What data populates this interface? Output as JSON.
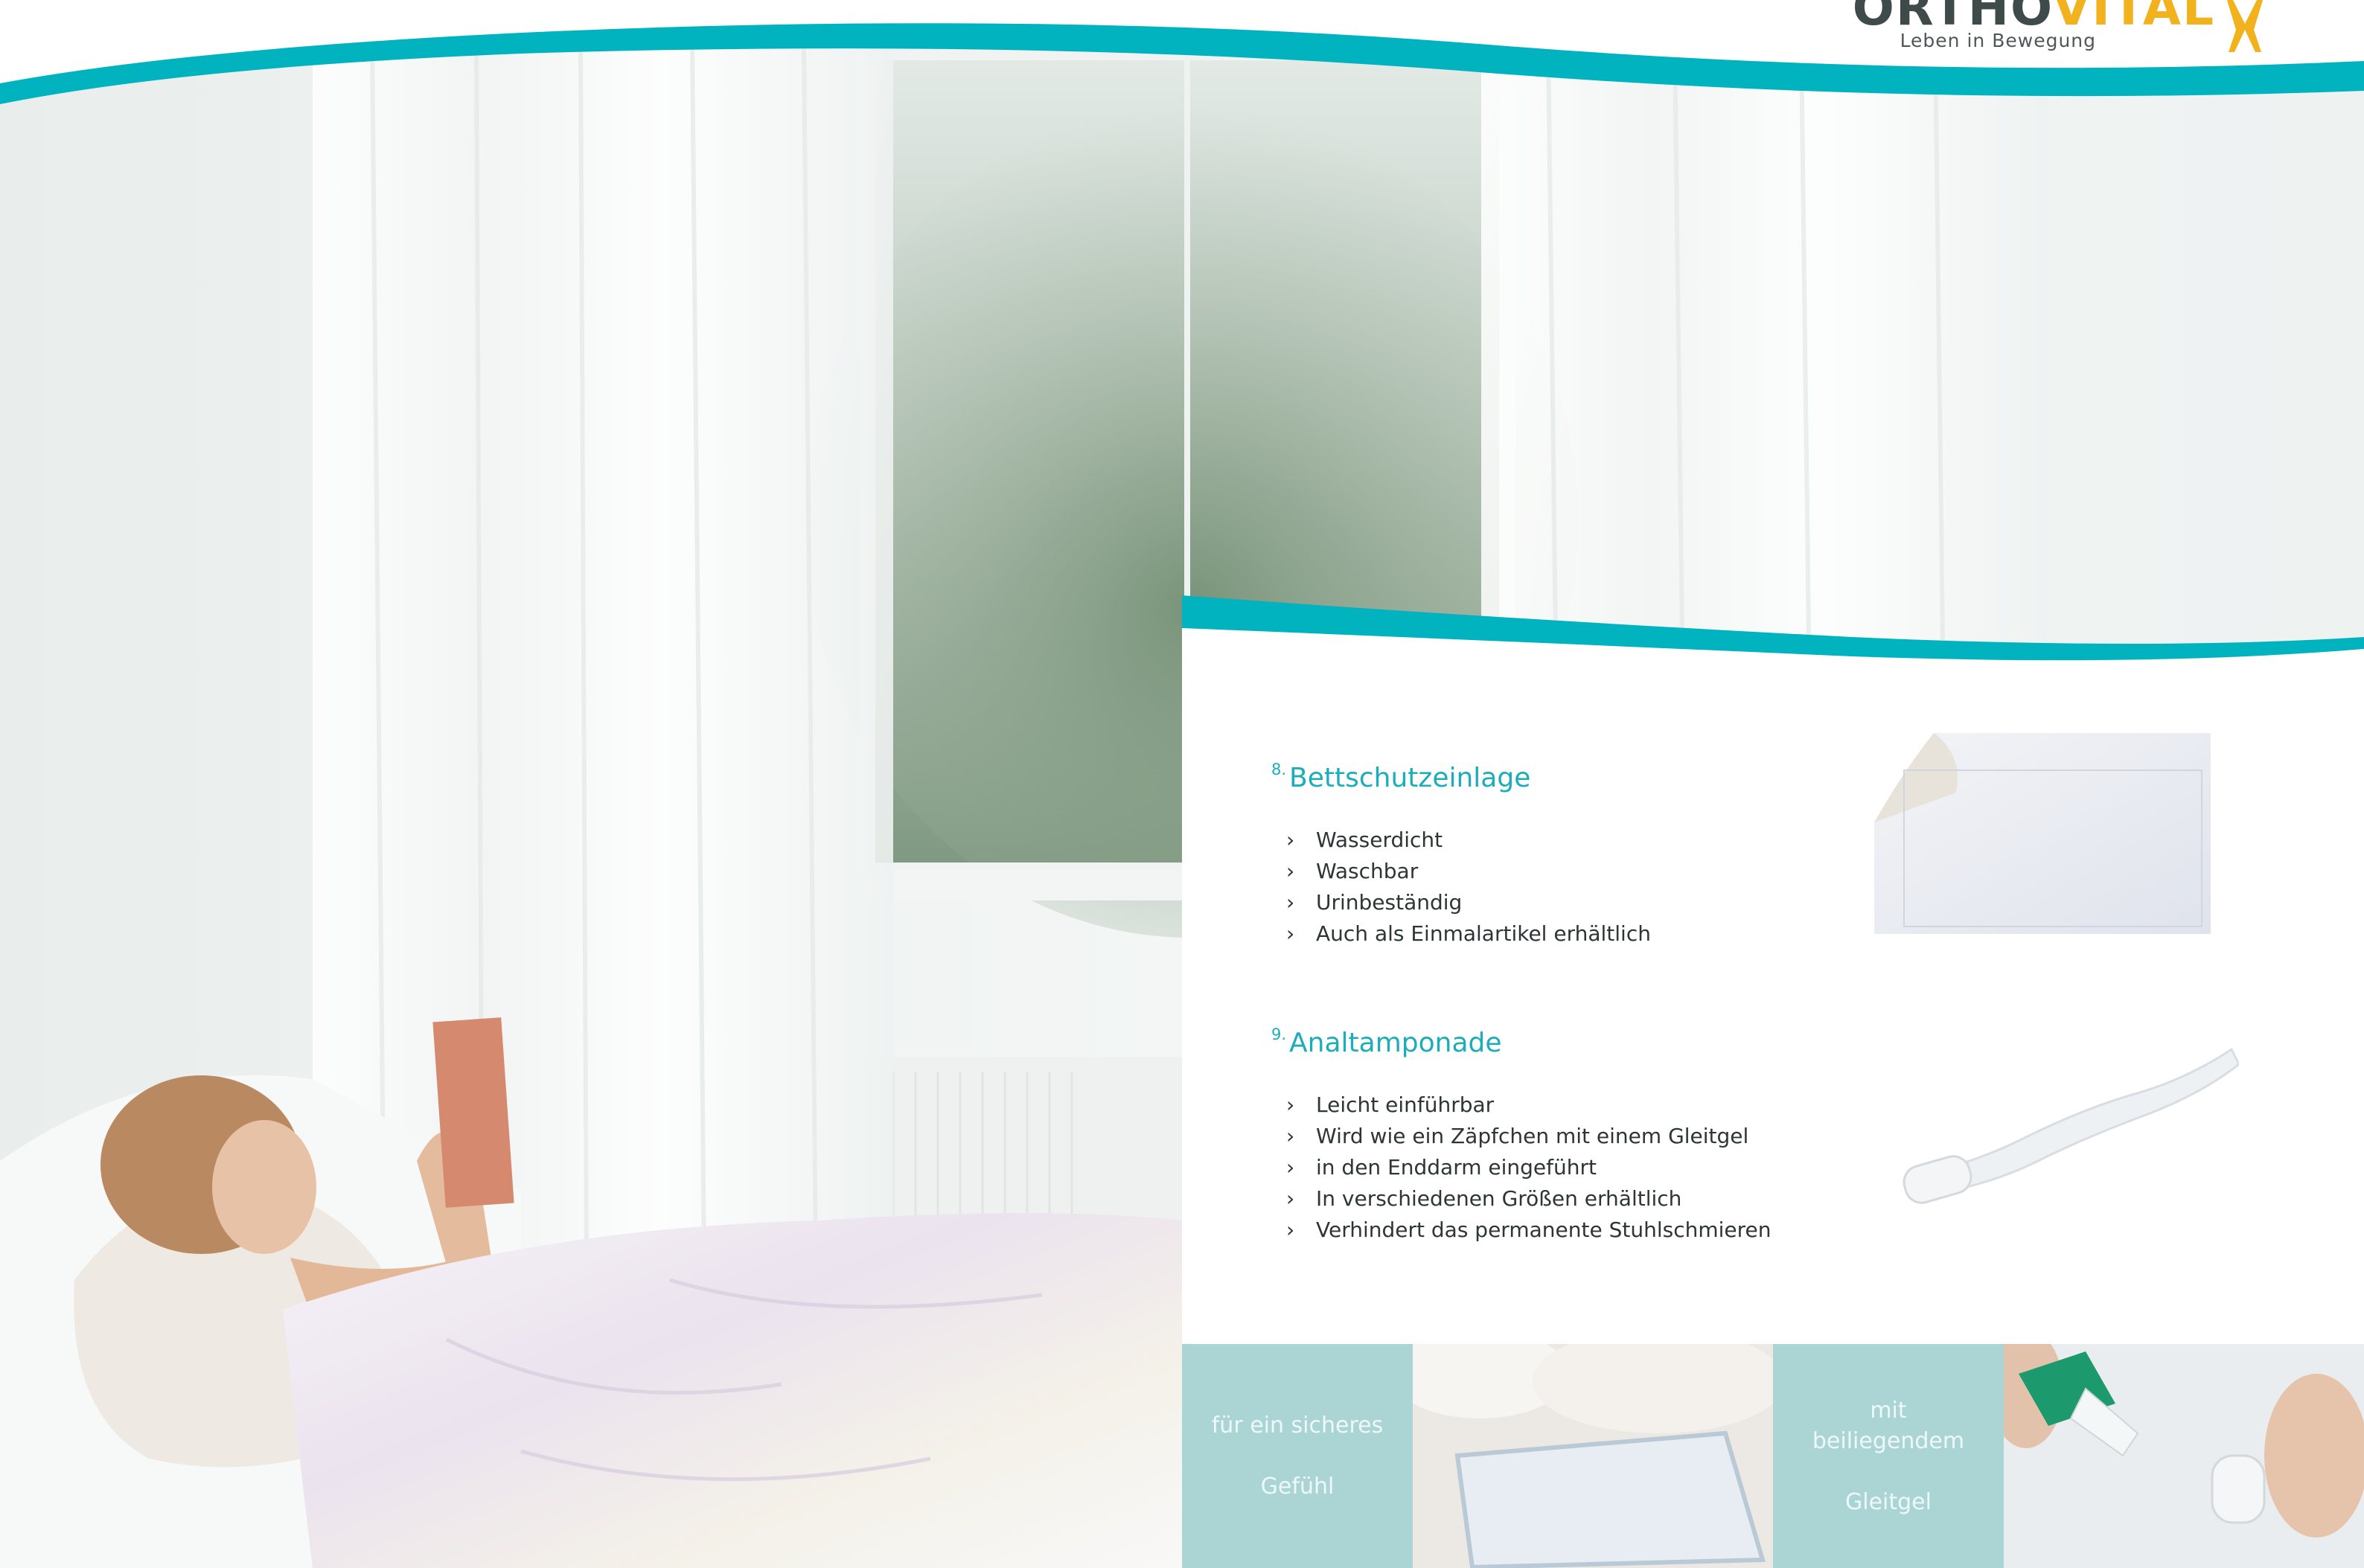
{
  "brand": {
    "name_part1": "ORTHO",
    "name_part2": "VITAL",
    "tagline": "Leben in Bewegung",
    "teal": "#00b3bf",
    "yellow": "#f2b21d"
  },
  "products": [
    {
      "number": "8.",
      "title": "Bettschutzeinlage",
      "features": [
        "Wasserdicht",
        "Waschbar",
        "Urinbeständig",
        "Auch als Einmalartikel erhältlich"
      ]
    },
    {
      "number": "9.",
      "title": "Analtamponade",
      "features": [
        "Leicht einführbar",
        "Wird wie ein Zäpfchen mit einem Gleitgel",
        "in den Enddarm eingeführt",
        "In verschiedenen Größen erhältlich",
        "Verhindert das permanente Stuhlschmieren"
      ]
    }
  ],
  "bottom_strip": {
    "tile_1": [
      "für ein sicheres",
      "Gefühl"
    ],
    "tile_2": [
      "mit beiliegendem",
      "Gleitgel"
    ]
  }
}
